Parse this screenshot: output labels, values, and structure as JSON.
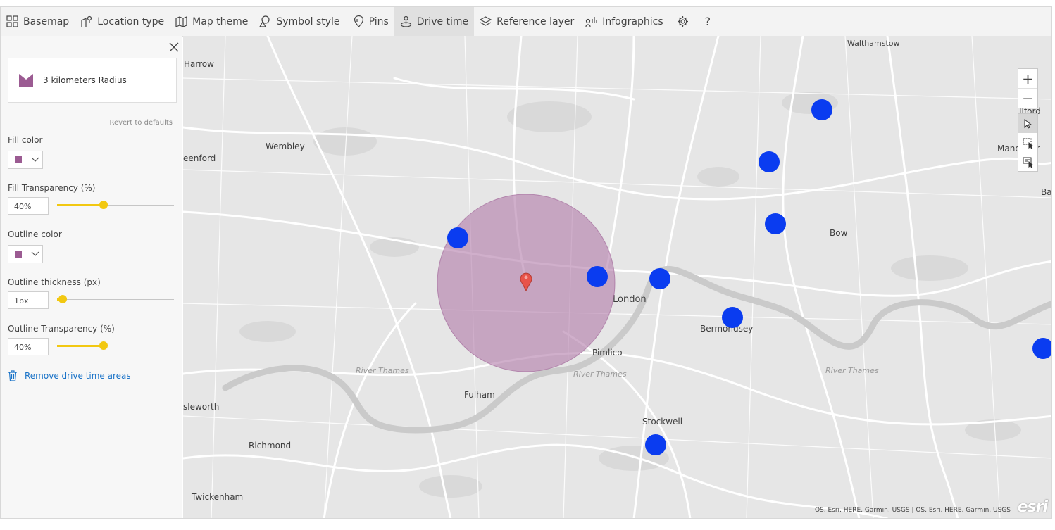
{
  "toolbar": {
    "items": [
      {
        "label": "Basemap",
        "icon": "grid-icon"
      },
      {
        "label": "Location type",
        "icon": "location-type-icon"
      },
      {
        "label": "Map theme",
        "icon": "map-icon"
      },
      {
        "label": "Symbol style",
        "icon": "shapes-icon"
      },
      {
        "label": "Pins",
        "icon": "pin-icon"
      },
      {
        "label": "Drive time",
        "icon": "drive-time-icon",
        "active": true
      },
      {
        "label": "Reference layer",
        "icon": "layers-icon"
      },
      {
        "label": "Infographics",
        "icon": "infographics-icon"
      }
    ],
    "settings_icon": "gear-icon",
    "help_label": "?"
  },
  "panel": {
    "radius_label": "3 kilometers Radius",
    "revert_label": "Revert to defaults",
    "fill_color_label": "Fill color",
    "fill_color": "#9b5b92",
    "fill_transparency_label": "Fill Transparency (%)",
    "fill_transparency_value": "40%",
    "fill_transparency_level": 0.4,
    "outline_color_label": "Outline color",
    "outline_color": "#9b5b92",
    "outline_thickness_label": "Outline thickness (px)",
    "outline_thickness_value": "1px",
    "outline_thickness_level": 0.05,
    "outline_transparency_label": "Outline Transparency (%)",
    "outline_transparency_value": "40%",
    "outline_transparency_level": 0.4,
    "remove_label": "Remove drive time areas"
  },
  "map": {
    "places": {
      "walthamstow": "Walthamstow",
      "harrow": "Harrow",
      "wembley": "Wembley",
      "greenford": "eenford",
      "ilford": "Ilford",
      "manor_park": "Manor Par",
      "barking": "Ba",
      "bow": "Bow",
      "london": "London",
      "bermondsey": "Bermondsey",
      "pimlico": "Pimlico",
      "river1": "River Thames",
      "river2": "River Thames",
      "river3": "River Thames",
      "fulham": "Fulham",
      "isleworth": "sleworth",
      "stockwell": "Stockwell",
      "richmond": "Richmond",
      "twickenham": "Twickenham"
    },
    "zoom_in": "+",
    "zoom_out": "—",
    "attribution": "OS, Esri, HERE, Garmin, USGS | OS, Esri, HERE, Garmin, USGS",
    "logo": "esri",
    "point_color": "#0a3cf0",
    "pin_color": "#e8534a",
    "area_color": "#b07aa8"
  }
}
